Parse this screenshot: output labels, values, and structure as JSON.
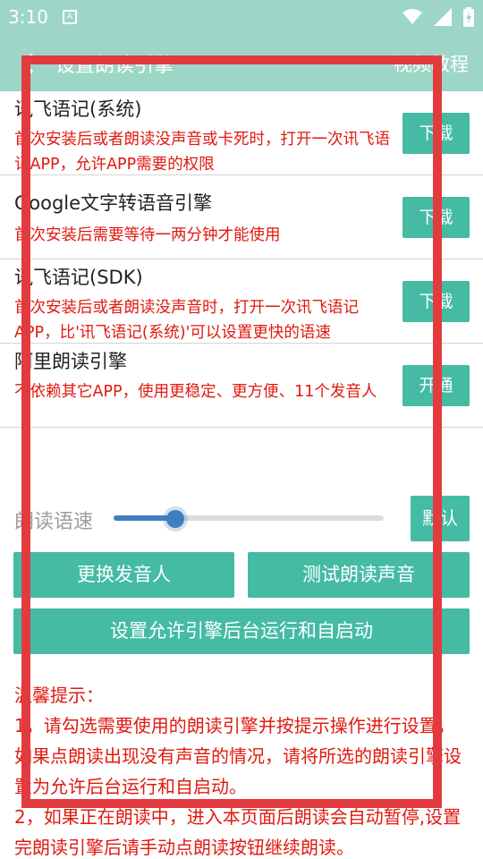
{
  "status": {
    "time": "3:10",
    "notif_icon": "A"
  },
  "toolbar": {
    "title": "设置朗读引擎",
    "action": "视频教程"
  },
  "engines": [
    {
      "name": "讯飞语记(系统)",
      "desc": "首次安装后或者朗读没声音或卡死时，打开一次讯飞语记APP，允许APP需要的权限",
      "button": "下载"
    },
    {
      "name": "Google文字转语音引擎",
      "desc": "首次安装后需要等待一两分钟才能使用",
      "button": "下载"
    },
    {
      "name": "讯飞语记(SDK)",
      "desc": "首次安装后或者朗读没声音时，打开一次讯飞语记APP，比'讯飞语记(系统)'可以设置更快的语速",
      "button": "下载"
    },
    {
      "name": "阿里朗读引擎",
      "desc": "不依赖其它APP，使用更稳定、更方便、11个发音人",
      "button": "开通"
    }
  ],
  "speed": {
    "label": "朗读语速",
    "value": 0.23,
    "default_button": "默认"
  },
  "buttons": {
    "change_voice": "更换发音人",
    "test_voice": "测试朗读声音",
    "background_run": "设置允许引擎后台运行和自启动"
  },
  "tips": {
    "title": "温馨提示：",
    "line1": "1，请勾选需要使用的朗读引擎并按提示操作进行设置，如果点朗读出现没有声音的情况，请将所选的朗读引擎设置为允许后台运行和自启动。",
    "line2": "2，如果正在朗读中，进入本页面后朗读会自动暂停,设置完朗读引擎后请手动点朗读按钮继续朗读。"
  },
  "colors": {
    "header": "#9dd6c7",
    "accent": "#45bba4",
    "warning": "#e0190f",
    "overlay": "#e23b3f",
    "slider": "#3e7fc1"
  }
}
